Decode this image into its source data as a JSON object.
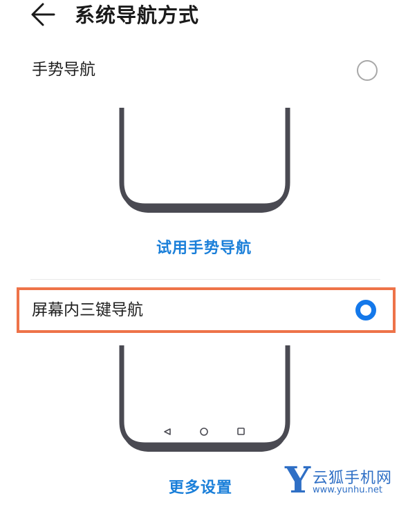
{
  "header": {
    "title": "系统导航方式",
    "back_icon": "arrow-left-icon"
  },
  "options": {
    "gesture": {
      "label": "手势导航",
      "selected": false
    },
    "three_key": {
      "label": "屏幕内三键导航",
      "selected": true
    }
  },
  "links": {
    "try_gesture": "试用手势导航",
    "more_settings": "更多设置"
  },
  "nav_keys": [
    "back-triangle-icon",
    "home-circle-icon",
    "recent-square-icon"
  ],
  "watermark": {
    "name": "云狐手机网",
    "url": "www.yunhu.net"
  },
  "colors": {
    "accent": "#1478ea",
    "link": "#1a7fd9",
    "highlight_border": "#ee7349",
    "phone_frame": "#4a4a52"
  }
}
